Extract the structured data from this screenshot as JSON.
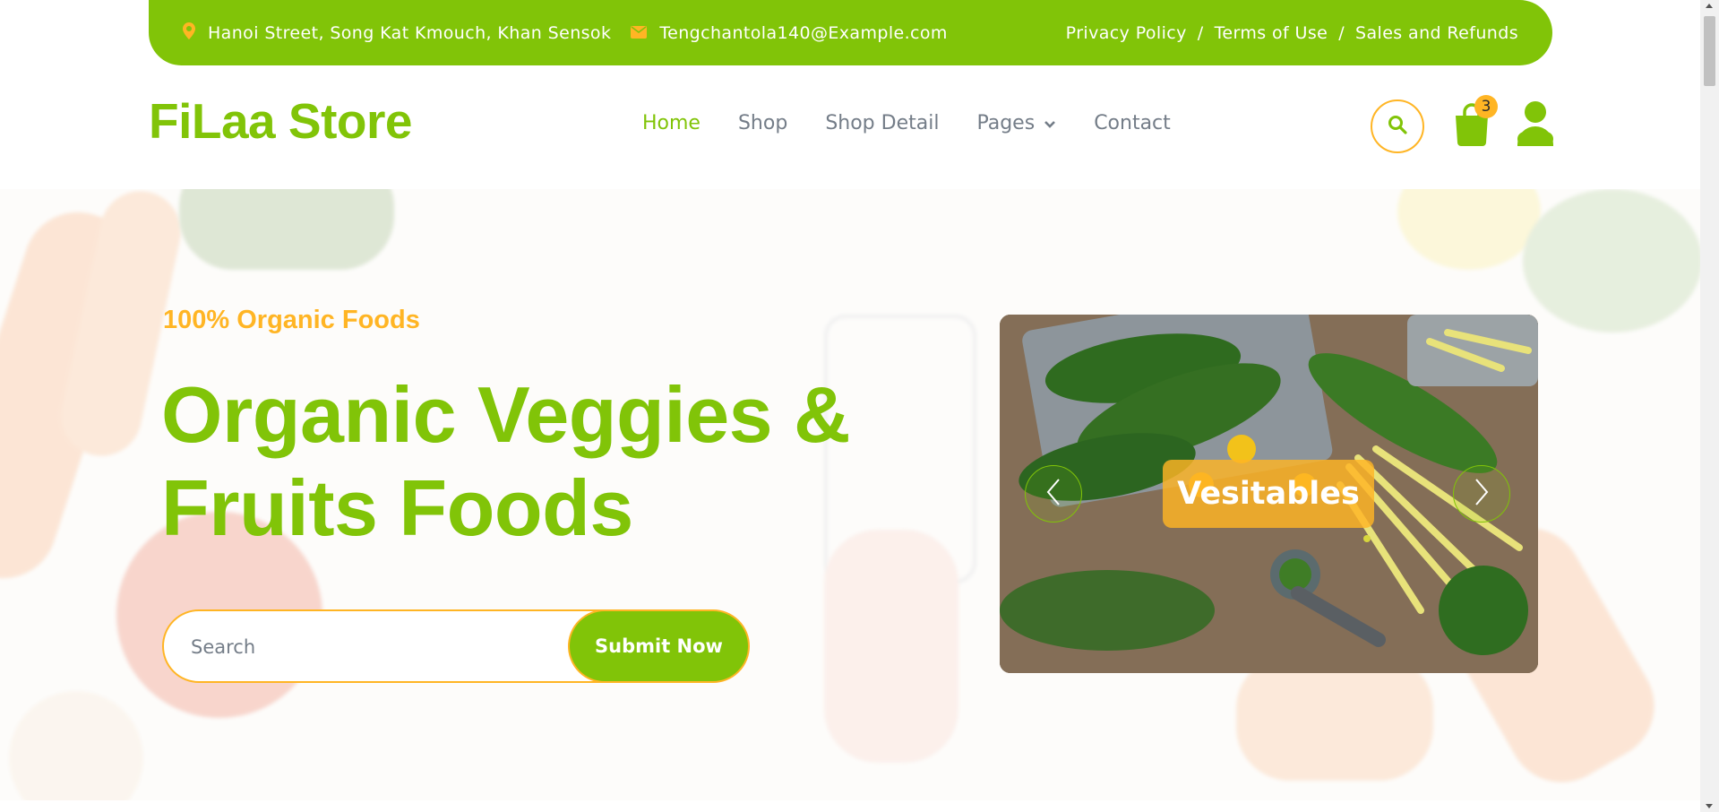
{
  "colors": {
    "primary": "#81c408",
    "accent": "#ffb524",
    "text": "#747d88"
  },
  "topbar": {
    "address": "Hanoi Street, Song Kat Kmouch, Khan Sensok",
    "address_icon": "map-marker-icon",
    "email": "Tengchantola140@Example.com",
    "email_icon": "envelope-icon",
    "links": [
      "Privacy Policy",
      "Terms of Use",
      "Sales and Refunds"
    ],
    "separator": "/"
  },
  "navbar": {
    "brand": "FiLaa Store",
    "items": [
      {
        "label": "Home",
        "active": true
      },
      {
        "label": "Shop",
        "active": false
      },
      {
        "label": "Shop Detail",
        "active": false
      },
      {
        "label": "Pages",
        "active": false,
        "dropdown": true
      },
      {
        "label": "Contact",
        "active": false
      }
    ],
    "cart_count": "3",
    "icons": [
      "search-icon",
      "shopping-bag-icon",
      "user-icon"
    ]
  },
  "hero": {
    "subtitle": "100% Organic Foods",
    "title_line1": "Organic Veggies &",
    "title_line2": "Fruits Foods",
    "search_placeholder": "Search",
    "submit_label": "Submit Now",
    "carousel": {
      "label": "Vesitables",
      "prev_icon": "chevron-left-icon",
      "next_icon": "chevron-right-icon"
    }
  }
}
